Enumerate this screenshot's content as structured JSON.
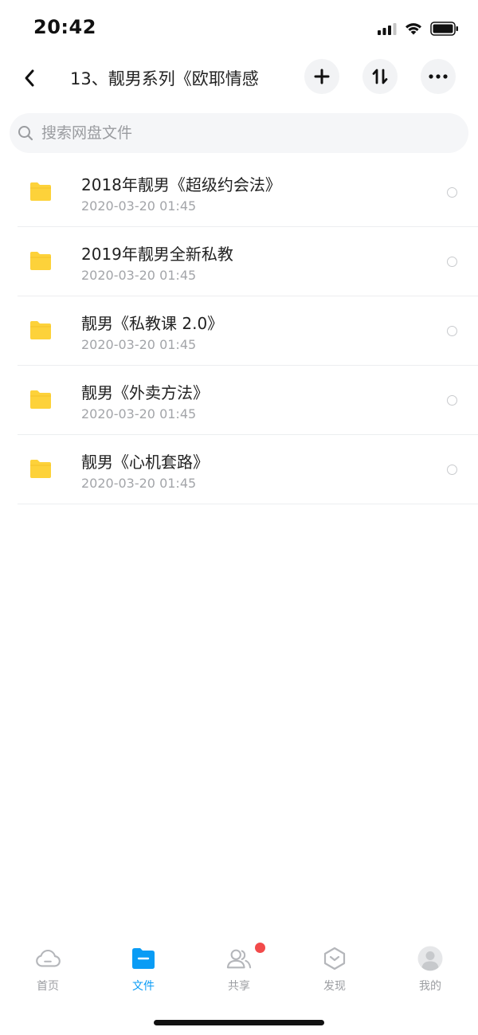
{
  "status_bar": {
    "time": "20:42"
  },
  "header": {
    "title": "13、靓男系列《欧耶情感",
    "icons": [
      "back-icon",
      "plus-icon",
      "sort-icon",
      "more-icon"
    ]
  },
  "search": {
    "placeholder": "搜索网盘文件",
    "value": ""
  },
  "files": [
    {
      "name": "2018年靓男《超级约会法》",
      "date": "2020-03-20 01:45"
    },
    {
      "name": "2019年靓男全新私教",
      "date": "2020-03-20 01:45"
    },
    {
      "name": "靓男《私教课 2.0》",
      "date": "2020-03-20 01:45"
    },
    {
      "name": "靓男《外卖方法》",
      "date": "2020-03-20 01:45"
    },
    {
      "name": "靓男《心机套路》",
      "date": "2020-03-20 01:45"
    }
  ],
  "tabs": [
    {
      "label": "首页",
      "icon": "cloud-icon",
      "active": false
    },
    {
      "label": "文件",
      "icon": "folder-icon",
      "active": true
    },
    {
      "label": "共享",
      "icon": "users-icon",
      "active": false,
      "badge": true
    },
    {
      "label": "发现",
      "icon": "discover-icon",
      "active": false
    },
    {
      "label": "我的",
      "icon": "avatar-icon",
      "active": false
    }
  ],
  "colors": {
    "accent": "#0a9cf5",
    "folder": "#fdd23a",
    "badge": "#f24a4a",
    "muted": "#9c9ea2"
  }
}
